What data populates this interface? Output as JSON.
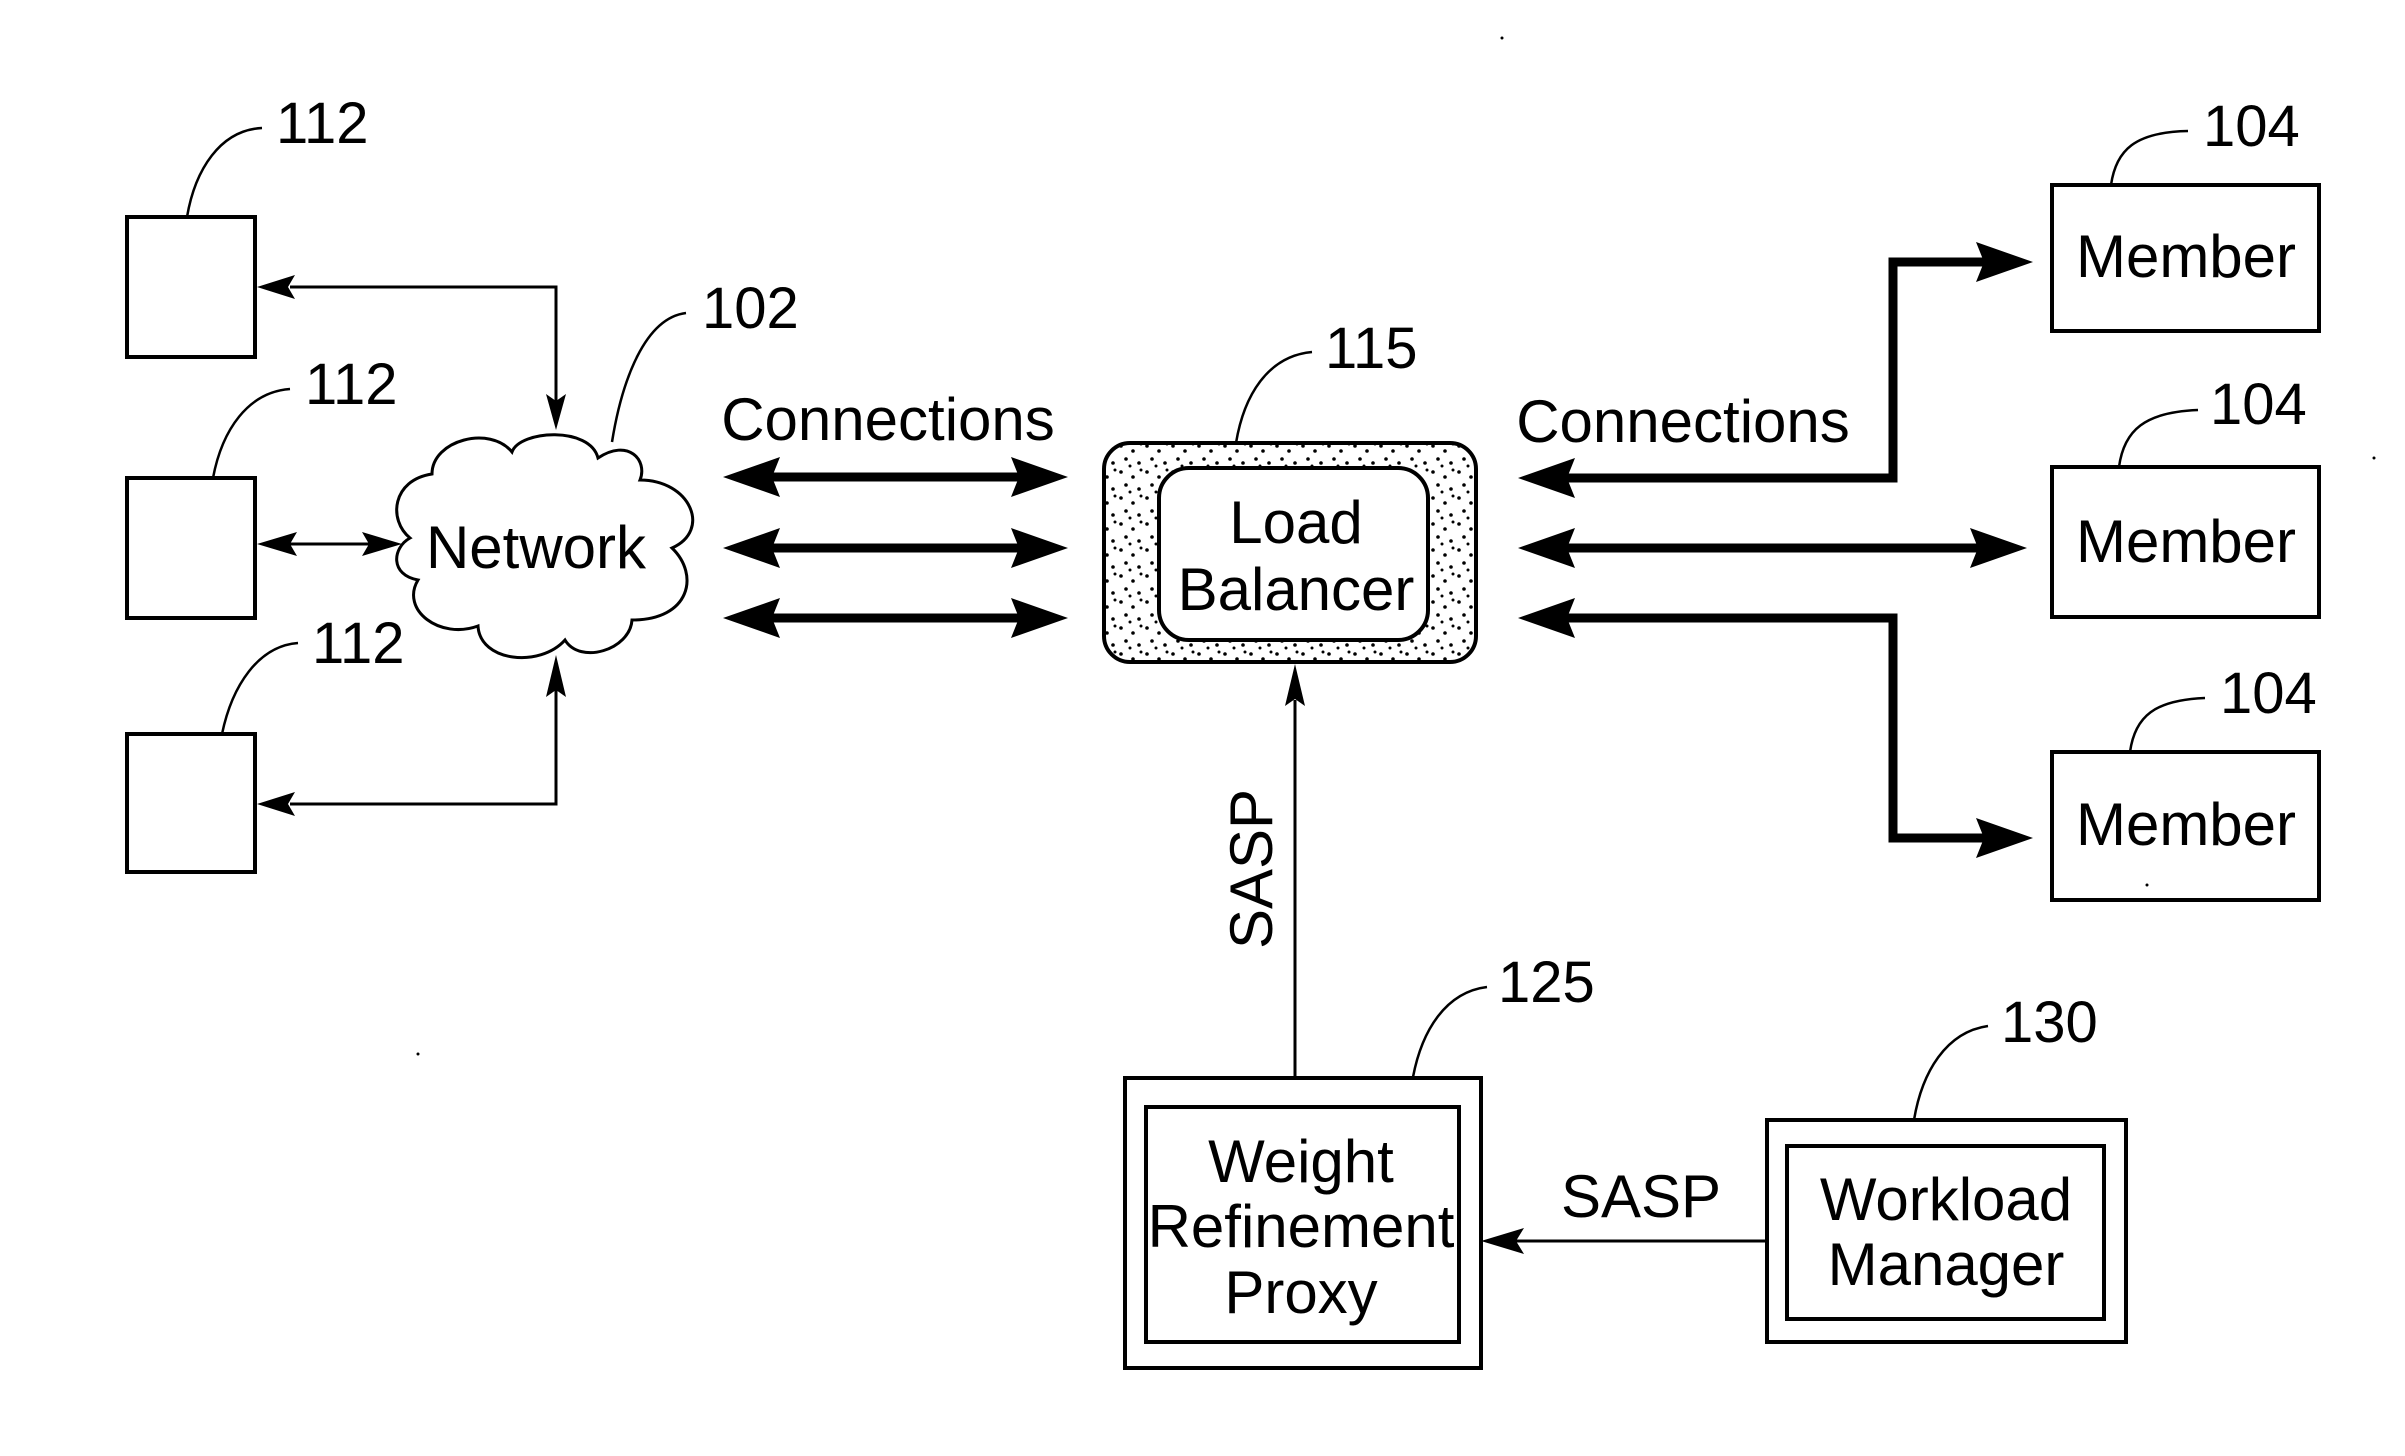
{
  "figure": {
    "clients": [
      {
        "ref": "112"
      },
      {
        "ref": "112"
      },
      {
        "ref": "112"
      }
    ],
    "network": {
      "label": "Network",
      "ref": "102"
    },
    "left_connections_label": "Connections",
    "load_balancer": {
      "line1": "Load",
      "line2": "Balancer",
      "ref": "115"
    },
    "right_connections_label": "Connections",
    "members": [
      {
        "label": "Member",
        "ref": "104"
      },
      {
        "label": "Member",
        "ref": "104"
      },
      {
        "label": "Member",
        "ref": "104"
      }
    ],
    "sasp_vertical_label": "SASP",
    "weight_refinement_proxy": {
      "line1": "Weight",
      "line2": "Refinement",
      "line3": "Proxy",
      "ref": "125"
    },
    "sasp_horizontal_label": "SASP",
    "workload_manager": {
      "line1": "Workload",
      "line2": "Manager",
      "ref": "130"
    }
  }
}
